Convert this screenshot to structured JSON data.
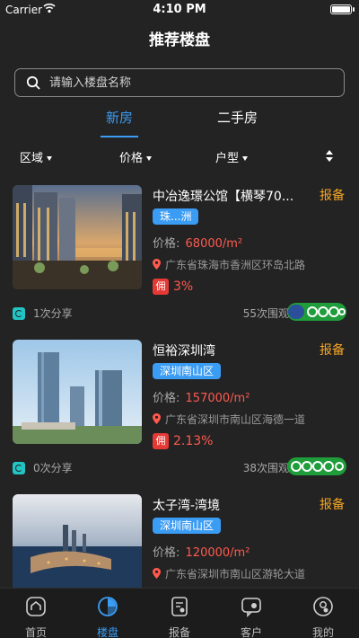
{
  "status_bar": {
    "carrier": "Carrier",
    "time": "4:10 PM"
  },
  "header": {
    "title": "推荐楼盘"
  },
  "search": {
    "placeholder": "请输入楼盘名称"
  },
  "tabs": [
    {
      "label": "新房",
      "active": true
    },
    {
      "label": "二手房",
      "active": false
    }
  ],
  "filters": [
    "区域",
    "价格",
    "户型"
  ],
  "listings": [
    {
      "name": "中冶逸璟公馆【横琴70...",
      "report_label": "报备",
      "tag": "珠...洲",
      "price_label": "价格:",
      "price": "68000/m²",
      "address": "广东省珠海市香洲区环岛北路",
      "commission_badge": "佣",
      "commission": "3%",
      "shares": "1次分享",
      "views": "55次围观"
    },
    {
      "name": "恒裕深圳湾",
      "report_label": "报备",
      "tag": "深圳南山区",
      "price_label": "价格:",
      "price": "157000/m²",
      "address": "广东省深圳市南山区海德一道",
      "commission_badge": "佣",
      "commission": "2.13%",
      "shares": "0次分享",
      "views": "38次围观"
    },
    {
      "name": "太子湾-湾境",
      "report_label": "报备",
      "tag": "深圳南山区",
      "price_label": "价格:",
      "price": "120000/m²",
      "address": "广东省深圳市南山区游轮大道"
    }
  ],
  "tab_bar": [
    {
      "label": "首页",
      "icon": "home-icon",
      "active": false
    },
    {
      "label": "楼盘",
      "icon": "building-icon",
      "active": true
    },
    {
      "label": "报备",
      "icon": "report-icon",
      "active": false
    },
    {
      "label": "客户",
      "icon": "customer-icon",
      "active": false
    },
    {
      "label": "我的",
      "icon": "profile-icon",
      "active": false
    }
  ],
  "colors": {
    "accent": "#3b9cf4",
    "report": "#f5a623",
    "price": "#ff5a4e",
    "background": "#232323"
  }
}
